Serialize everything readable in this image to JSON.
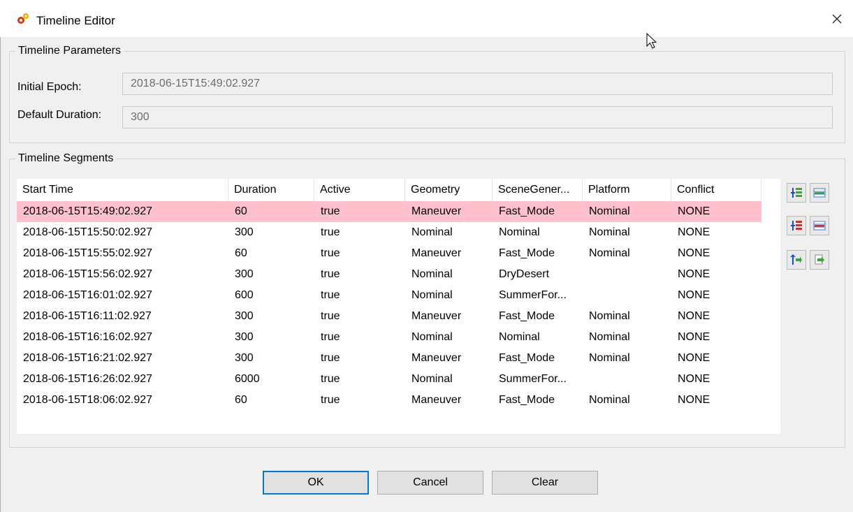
{
  "window": {
    "title": "Timeline Editor",
    "icon": "gears-icon",
    "close_glyph": "✕"
  },
  "parameters": {
    "legend": "Timeline Parameters",
    "initial_epoch_label": "Initial Epoch:",
    "initial_epoch_value": "2018-06-15T15:49:02.927",
    "default_duration_label": "Default Duration:",
    "default_duration_value": "300"
  },
  "segments": {
    "legend": "Timeline Segments",
    "columns": [
      "Start Time",
      "Duration",
      "Active",
      "Geometry",
      "SceneGener...",
      "Platform",
      "Conflict"
    ],
    "selected_row_index": 0,
    "selected_row_color": "#ffc0cb",
    "rows": [
      [
        "2018-06-15T15:49:02.927",
        "60",
        "true",
        "Maneuver",
        "Fast_Mode",
        "Nominal",
        "NONE"
      ],
      [
        "2018-06-15T15:50:02.927",
        "300",
        "true",
        "Nominal",
        "Nominal",
        "Nominal",
        "NONE"
      ],
      [
        "2018-06-15T15:55:02.927",
        "60",
        "true",
        "Maneuver",
        "Fast_Mode",
        "Nominal",
        "NONE"
      ],
      [
        "2018-06-15T15:56:02.927",
        "300",
        "true",
        "Nominal",
        "DryDesert",
        "",
        "NONE"
      ],
      [
        "2018-06-15T16:01:02.927",
        "600",
        "true",
        "Nominal",
        "SummerFor...",
        "",
        "NONE"
      ],
      [
        "2018-06-15T16:11:02.927",
        "300",
        "true",
        "Maneuver",
        "Fast_Mode",
        "Nominal",
        "NONE"
      ],
      [
        "2018-06-15T16:16:02.927",
        "300",
        "true",
        "Nominal",
        "Nominal",
        "Nominal",
        "NONE"
      ],
      [
        "2018-06-15T16:21:02.927",
        "300",
        "true",
        "Maneuver",
        "Fast_Mode",
        "Nominal",
        "NONE"
      ],
      [
        "2018-06-15T16:26:02.927",
        "6000",
        "true",
        "Nominal",
        "SummerFor...",
        "",
        "NONE"
      ],
      [
        "2018-06-15T18:06:02.927",
        "60",
        "true",
        "Maneuver",
        "Fast_Mode",
        "Nominal",
        "NONE"
      ]
    ],
    "side_buttons": [
      {
        "name": "insert-row-before-icon"
      },
      {
        "name": "insert-row-after-icon"
      },
      {
        "name": "delete-row-icon"
      },
      {
        "name": "delete-table-row-icon"
      },
      {
        "name": "move-row-icon"
      },
      {
        "name": "copy-row-icon"
      }
    ]
  },
  "buttons": {
    "ok": "OK",
    "cancel": "Cancel",
    "clear": "Clear"
  },
  "colors": {
    "accent": "#0078d7"
  }
}
